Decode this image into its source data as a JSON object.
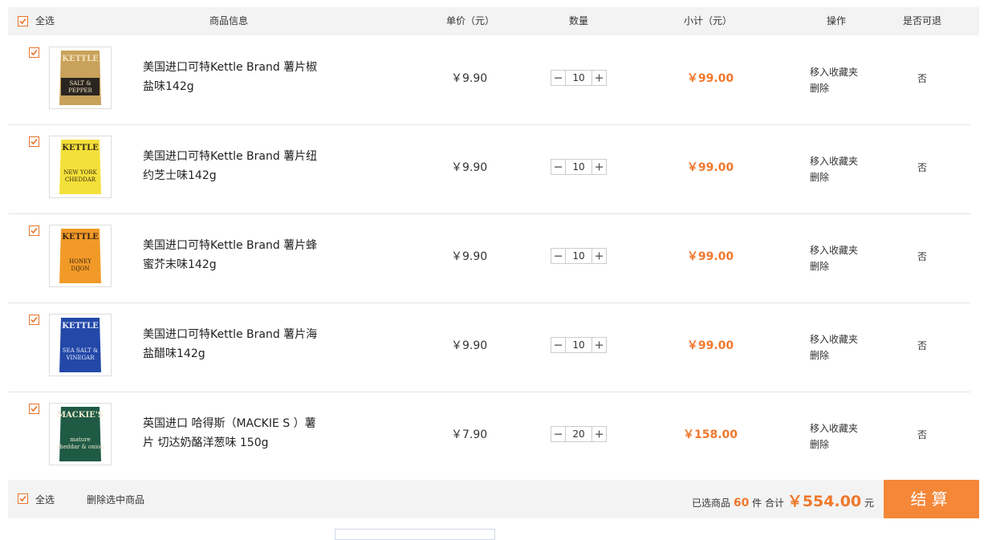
{
  "header": {
    "select_all": "全选",
    "product_info": "商品信息",
    "unit_price": "单价（元）",
    "quantity": "数量",
    "subtotal": "小计（元）",
    "actions": "操作",
    "returnable": "是否可退"
  },
  "items": [
    {
      "name": "美国进口可特Kettle Brand 薯片椒盐味142g",
      "price": "￥9.90",
      "qty": "10",
      "subtotal": "￥99.00",
      "move_fav": "移入收藏夹",
      "delete": "删除",
      "returnable": "否",
      "checked": true,
      "thumb": {
        "brand": "KETTLE",
        "flavor1": "SALT &",
        "flavor2": "PEPPER",
        "bg": "#c8a25a",
        "band": "#2a2520",
        "textcolor": "#f3e4c2"
      }
    },
    {
      "name": "美国进口可特Kettle Brand 薯片纽约芝士味142g",
      "price": "￥9.90",
      "qty": "10",
      "subtotal": "￥99.00",
      "move_fav": "移入收藏夹",
      "delete": "删除",
      "returnable": "否",
      "checked": true,
      "thumb": {
        "brand": "KETTLE",
        "flavor1": "NEW YORK",
        "flavor2": "CHEDDAR",
        "bg": "#f3e03a",
        "band": "#f3e03a",
        "textcolor": "#3a2a10"
      }
    },
    {
      "name": "美国进口可特Kettle Brand 薯片蜂蜜芥末味142g",
      "price": "￥9.90",
      "qty": "10",
      "subtotal": "￥99.00",
      "move_fav": "移入收藏夹",
      "delete": "删除",
      "returnable": "否",
      "checked": true,
      "thumb": {
        "brand": "KETTLE",
        "flavor1": "HONEY",
        "flavor2": "DIJON",
        "bg": "#f29a28",
        "band": "#f29a28",
        "textcolor": "#3a2410"
      }
    },
    {
      "name": "美国进口可特Kettle Brand 薯片海盐醋味142g",
      "price": "￥9.90",
      "qty": "10",
      "subtotal": "￥99.00",
      "move_fav": "移入收藏夹",
      "delete": "删除",
      "returnable": "否",
      "checked": true,
      "thumb": {
        "brand": "KETTLE",
        "flavor1": "SEA SALT &",
        "flavor2": "VINEGAR",
        "bg": "#2348a8",
        "band": "#2348a8",
        "textcolor": "#e8eefa"
      }
    },
    {
      "name": "英国进口 哈得斯（MACKIE S ）薯片 切达奶酪洋葱味 150g",
      "price": "￥7.90",
      "qty": "20",
      "subtotal": "￥158.00",
      "move_fav": "移入收藏夹",
      "delete": "删除",
      "returnable": "否",
      "checked": true,
      "thumb": {
        "brand": "MACKIE'S",
        "flavor1": "mature",
        "flavor2": "cheddar & onion",
        "bg": "#1f5a45",
        "band": "#1f5a45",
        "textcolor": "#f0ead0"
      }
    }
  ],
  "footer": {
    "select_all": "全选",
    "delete_selected": "删除选中商品",
    "selected_prefix": "已选商品",
    "selected_count": "60",
    "selected_unit": "件 合计",
    "total": "￥554.00",
    "total_unit": "元",
    "checkout": "结算"
  },
  "colors": {
    "accent": "#f0782c",
    "checkout_bg": "#f58738"
  }
}
